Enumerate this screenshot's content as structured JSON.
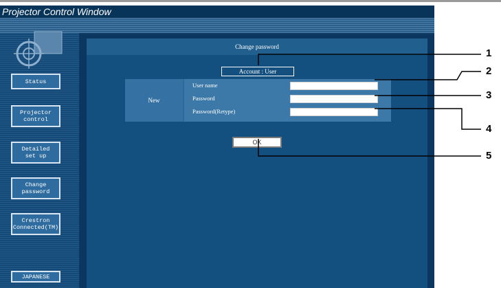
{
  "window": {
    "title": "Projector Control Window"
  },
  "sidebar": {
    "items": [
      {
        "label": "Status"
      },
      {
        "label": "Projector\ncontrol"
      },
      {
        "label": "Detailed\nset up"
      },
      {
        "label": "Change\npassword"
      },
      {
        "label": "Crestron\nConnected(TM)"
      },
      {
        "label": "JAPANESE"
      }
    ]
  },
  "main": {
    "heading": "Change password",
    "account_label": "Account : User",
    "new_label": "New",
    "fields": [
      {
        "label": "User name",
        "value": ""
      },
      {
        "label": "Password",
        "value": ""
      },
      {
        "label": "Password(Retype)",
        "value": ""
      }
    ],
    "ok_label": "OK"
  },
  "callouts": [
    "1",
    "2",
    "3",
    "4",
    "5"
  ]
}
